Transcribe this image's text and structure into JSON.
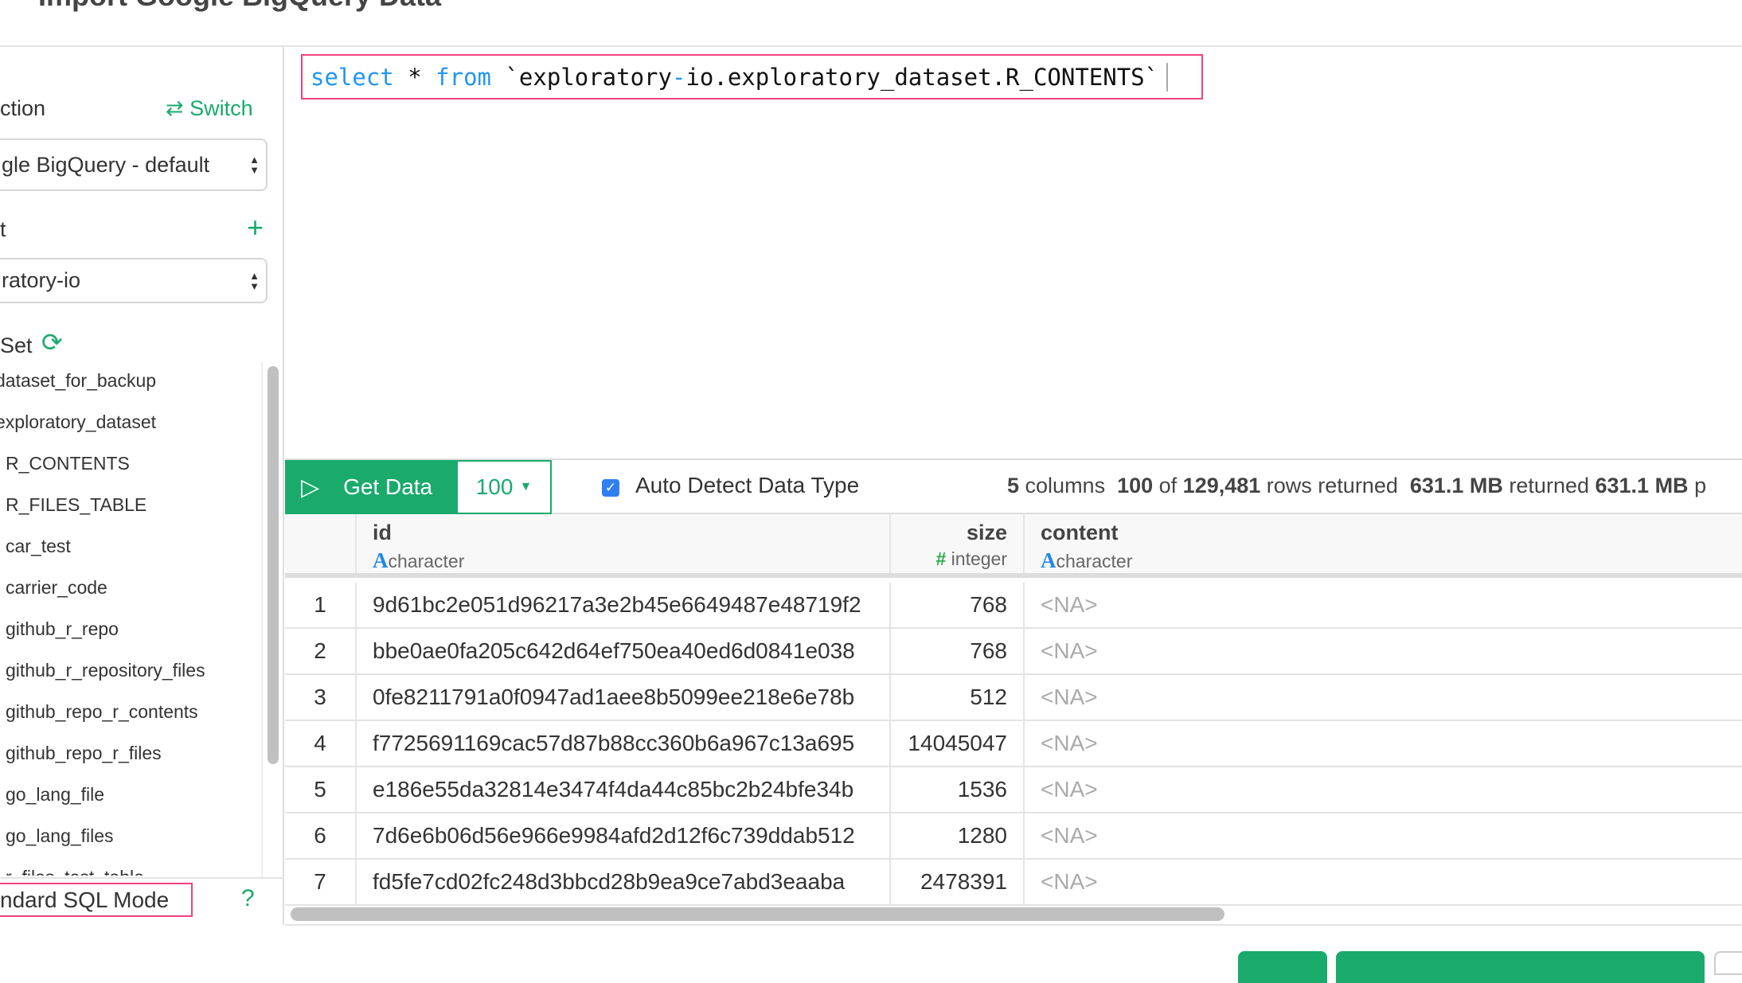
{
  "title": "Import Google BigQuery Data",
  "sidebar": {
    "connection_label": "ction",
    "switch_label": "Switch",
    "connection_value": "gle BigQuery - default",
    "project_label": "t",
    "project_value": "ratory-io",
    "dataset_label": "Set",
    "items": [
      "dataset_for_backup",
      "exploratory_dataset",
      "R_CONTENTS",
      "R_FILES_TABLE",
      "car_test",
      "carrier_code",
      "github_r_repo",
      "github_r_repository_files",
      "github_repo_r_contents",
      "github_repo_r_files",
      "go_lang_file",
      "go_lang_files",
      "r_files_test_table"
    ],
    "sql_mode_label": "ndard SQL Mode"
  },
  "query": {
    "kw1": "select",
    "star": " * ",
    "kw2": "from",
    "rest1": " `exploratory",
    "dash": "-",
    "rest2": "io.exploratory_dataset.R_CONTENTS`"
  },
  "toolbar": {
    "get_data": "Get Data",
    "limit": "100",
    "auto_detect": "Auto Detect Data Type",
    "auto_detect_checked": true,
    "status": {
      "cols": "5",
      "cols_t": " columns  ",
      "rows": "100",
      "of": " of ",
      "total": "129,481",
      "rows_t": " rows returned  ",
      "mb": "631.1 MB",
      "mb_t": " returned ",
      "mb2": "631.1 MB",
      "tail": " p"
    }
  },
  "table": {
    "columns": [
      {
        "name": "id",
        "type": "character",
        "icon": "A"
      },
      {
        "name": "size",
        "type": "integer",
        "icon": "#"
      },
      {
        "name": "content",
        "type": "character",
        "icon": "A"
      }
    ],
    "rows": [
      [
        "1",
        "9d61bc2e051d96217a3e2b45e6649487e48719f2",
        "768",
        "<NA>"
      ],
      [
        "2",
        "bbe0ae0fa205c642d64ef750ea40ed6d0841e038",
        "768",
        "<NA>"
      ],
      [
        "3",
        "0fe8211791a0f0947ad1aee8b5099ee218e6e78b",
        "512",
        "<NA>"
      ],
      [
        "4",
        "f7725691169cac57d87b88cc360b6a967c13a695",
        "14045047",
        "<NA>"
      ],
      [
        "5",
        "e186e55da32814e3474f4da44c85bc2b24bfe34b",
        "1536",
        "<NA>"
      ],
      [
        "6",
        "7d6e6b06d56e966e9984afd2d12f6c739ddab512",
        "1280",
        "<NA>"
      ],
      [
        "7",
        "fd5fe7cd02fc248d3bbcd28b9ea9ce7abd3eaaba",
        "2478391",
        "<NA>"
      ]
    ]
  },
  "colors": {
    "accent": "#1aaa6c",
    "highlight": "#f0427b",
    "keyword": "#2196f3"
  }
}
